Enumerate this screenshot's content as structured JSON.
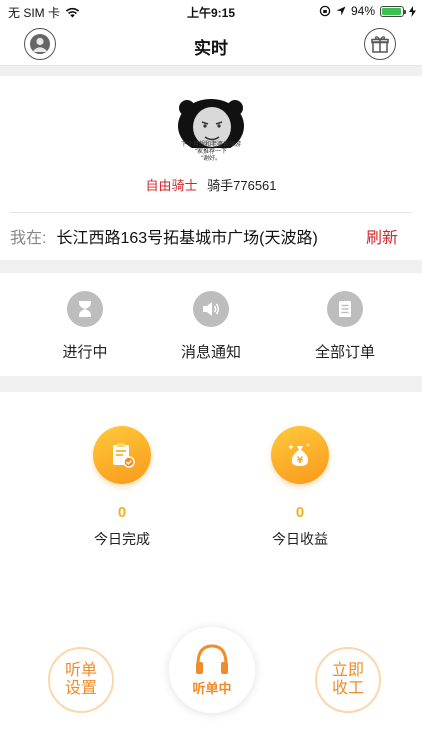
{
  "status_bar": {
    "carrier": "无 SIM 卡",
    "time": "上午9:15",
    "battery": "94%",
    "battery_level": 0.94
  },
  "nav": {
    "title": "实时"
  },
  "profile": {
    "avatar_caption": [
      "下个月想和老婆去旅游",
      "“家推荐一下",
      "“谢好。"
    ],
    "rider_type": "自由骑士",
    "rider_name": "骑手776561",
    "location_label": "我在:",
    "location_value": "长江西路163号拓基城市广场(天波路)",
    "refresh_label": "刷新"
  },
  "actions": [
    {
      "label": "进行中",
      "icon": "hourglass-icon"
    },
    {
      "label": "消息通知",
      "icon": "speaker-icon"
    },
    {
      "label": "全部订单",
      "icon": "document-list-icon"
    }
  ],
  "stats": [
    {
      "value": "0",
      "label": "今日完成",
      "icon": "clipboard-check-icon"
    },
    {
      "value": "0",
      "label": "今日收益",
      "icon": "money-bag-icon"
    }
  ],
  "bottom": {
    "settings_label_1": "听单",
    "settings_label_2": "设置",
    "listen_label": "听单中",
    "close_label_1": "立即",
    "close_label_2": "收工"
  },
  "colors": {
    "accent_red": "#d0282c",
    "accent_orange": "#f08c2a",
    "stat_orange": "#f99a1c"
  }
}
